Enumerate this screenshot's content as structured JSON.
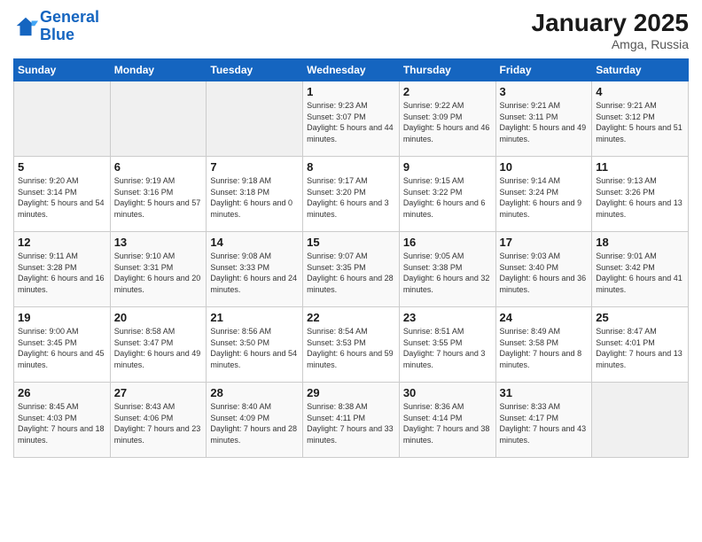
{
  "logo": {
    "line1": "General",
    "line2": "Blue"
  },
  "title": "January 2025",
  "location": "Amga, Russia",
  "weekdays": [
    "Sunday",
    "Monday",
    "Tuesday",
    "Wednesday",
    "Thursday",
    "Friday",
    "Saturday"
  ],
  "weeks": [
    [
      {
        "day": "",
        "sunrise": "",
        "sunset": "",
        "daylight": ""
      },
      {
        "day": "",
        "sunrise": "",
        "sunset": "",
        "daylight": ""
      },
      {
        "day": "",
        "sunrise": "",
        "sunset": "",
        "daylight": ""
      },
      {
        "day": "1",
        "sunrise": "9:23 AM",
        "sunset": "3:07 PM",
        "daylight": "5 hours and 44 minutes."
      },
      {
        "day": "2",
        "sunrise": "9:22 AM",
        "sunset": "3:09 PM",
        "daylight": "5 hours and 46 minutes."
      },
      {
        "day": "3",
        "sunrise": "9:21 AM",
        "sunset": "3:11 PM",
        "daylight": "5 hours and 49 minutes."
      },
      {
        "day": "4",
        "sunrise": "9:21 AM",
        "sunset": "3:12 PM",
        "daylight": "5 hours and 51 minutes."
      }
    ],
    [
      {
        "day": "5",
        "sunrise": "9:20 AM",
        "sunset": "3:14 PM",
        "daylight": "5 hours and 54 minutes."
      },
      {
        "day": "6",
        "sunrise": "9:19 AM",
        "sunset": "3:16 PM",
        "daylight": "5 hours and 57 minutes."
      },
      {
        "day": "7",
        "sunrise": "9:18 AM",
        "sunset": "3:18 PM",
        "daylight": "6 hours and 0 minutes."
      },
      {
        "day": "8",
        "sunrise": "9:17 AM",
        "sunset": "3:20 PM",
        "daylight": "6 hours and 3 minutes."
      },
      {
        "day": "9",
        "sunrise": "9:15 AM",
        "sunset": "3:22 PM",
        "daylight": "6 hours and 6 minutes."
      },
      {
        "day": "10",
        "sunrise": "9:14 AM",
        "sunset": "3:24 PM",
        "daylight": "6 hours and 9 minutes."
      },
      {
        "day": "11",
        "sunrise": "9:13 AM",
        "sunset": "3:26 PM",
        "daylight": "6 hours and 13 minutes."
      }
    ],
    [
      {
        "day": "12",
        "sunrise": "9:11 AM",
        "sunset": "3:28 PM",
        "daylight": "6 hours and 16 minutes."
      },
      {
        "day": "13",
        "sunrise": "9:10 AM",
        "sunset": "3:31 PM",
        "daylight": "6 hours and 20 minutes."
      },
      {
        "day": "14",
        "sunrise": "9:08 AM",
        "sunset": "3:33 PM",
        "daylight": "6 hours and 24 minutes."
      },
      {
        "day": "15",
        "sunrise": "9:07 AM",
        "sunset": "3:35 PM",
        "daylight": "6 hours and 28 minutes."
      },
      {
        "day": "16",
        "sunrise": "9:05 AM",
        "sunset": "3:38 PM",
        "daylight": "6 hours and 32 minutes."
      },
      {
        "day": "17",
        "sunrise": "9:03 AM",
        "sunset": "3:40 PM",
        "daylight": "6 hours and 36 minutes."
      },
      {
        "day": "18",
        "sunrise": "9:01 AM",
        "sunset": "3:42 PM",
        "daylight": "6 hours and 41 minutes."
      }
    ],
    [
      {
        "day": "19",
        "sunrise": "9:00 AM",
        "sunset": "3:45 PM",
        "daylight": "6 hours and 45 minutes."
      },
      {
        "day": "20",
        "sunrise": "8:58 AM",
        "sunset": "3:47 PM",
        "daylight": "6 hours and 49 minutes."
      },
      {
        "day": "21",
        "sunrise": "8:56 AM",
        "sunset": "3:50 PM",
        "daylight": "6 hours and 54 minutes."
      },
      {
        "day": "22",
        "sunrise": "8:54 AM",
        "sunset": "3:53 PM",
        "daylight": "6 hours and 59 minutes."
      },
      {
        "day": "23",
        "sunrise": "8:51 AM",
        "sunset": "3:55 PM",
        "daylight": "7 hours and 3 minutes."
      },
      {
        "day": "24",
        "sunrise": "8:49 AM",
        "sunset": "3:58 PM",
        "daylight": "7 hours and 8 minutes."
      },
      {
        "day": "25",
        "sunrise": "8:47 AM",
        "sunset": "4:01 PM",
        "daylight": "7 hours and 13 minutes."
      }
    ],
    [
      {
        "day": "26",
        "sunrise": "8:45 AM",
        "sunset": "4:03 PM",
        "daylight": "7 hours and 18 minutes."
      },
      {
        "day": "27",
        "sunrise": "8:43 AM",
        "sunset": "4:06 PM",
        "daylight": "7 hours and 23 minutes."
      },
      {
        "day": "28",
        "sunrise": "8:40 AM",
        "sunset": "4:09 PM",
        "daylight": "7 hours and 28 minutes."
      },
      {
        "day": "29",
        "sunrise": "8:38 AM",
        "sunset": "4:11 PM",
        "daylight": "7 hours and 33 minutes."
      },
      {
        "day": "30",
        "sunrise": "8:36 AM",
        "sunset": "4:14 PM",
        "daylight": "7 hours and 38 minutes."
      },
      {
        "day": "31",
        "sunrise": "8:33 AM",
        "sunset": "4:17 PM",
        "daylight": "7 hours and 43 minutes."
      },
      {
        "day": "",
        "sunrise": "",
        "sunset": "",
        "daylight": ""
      }
    ]
  ]
}
